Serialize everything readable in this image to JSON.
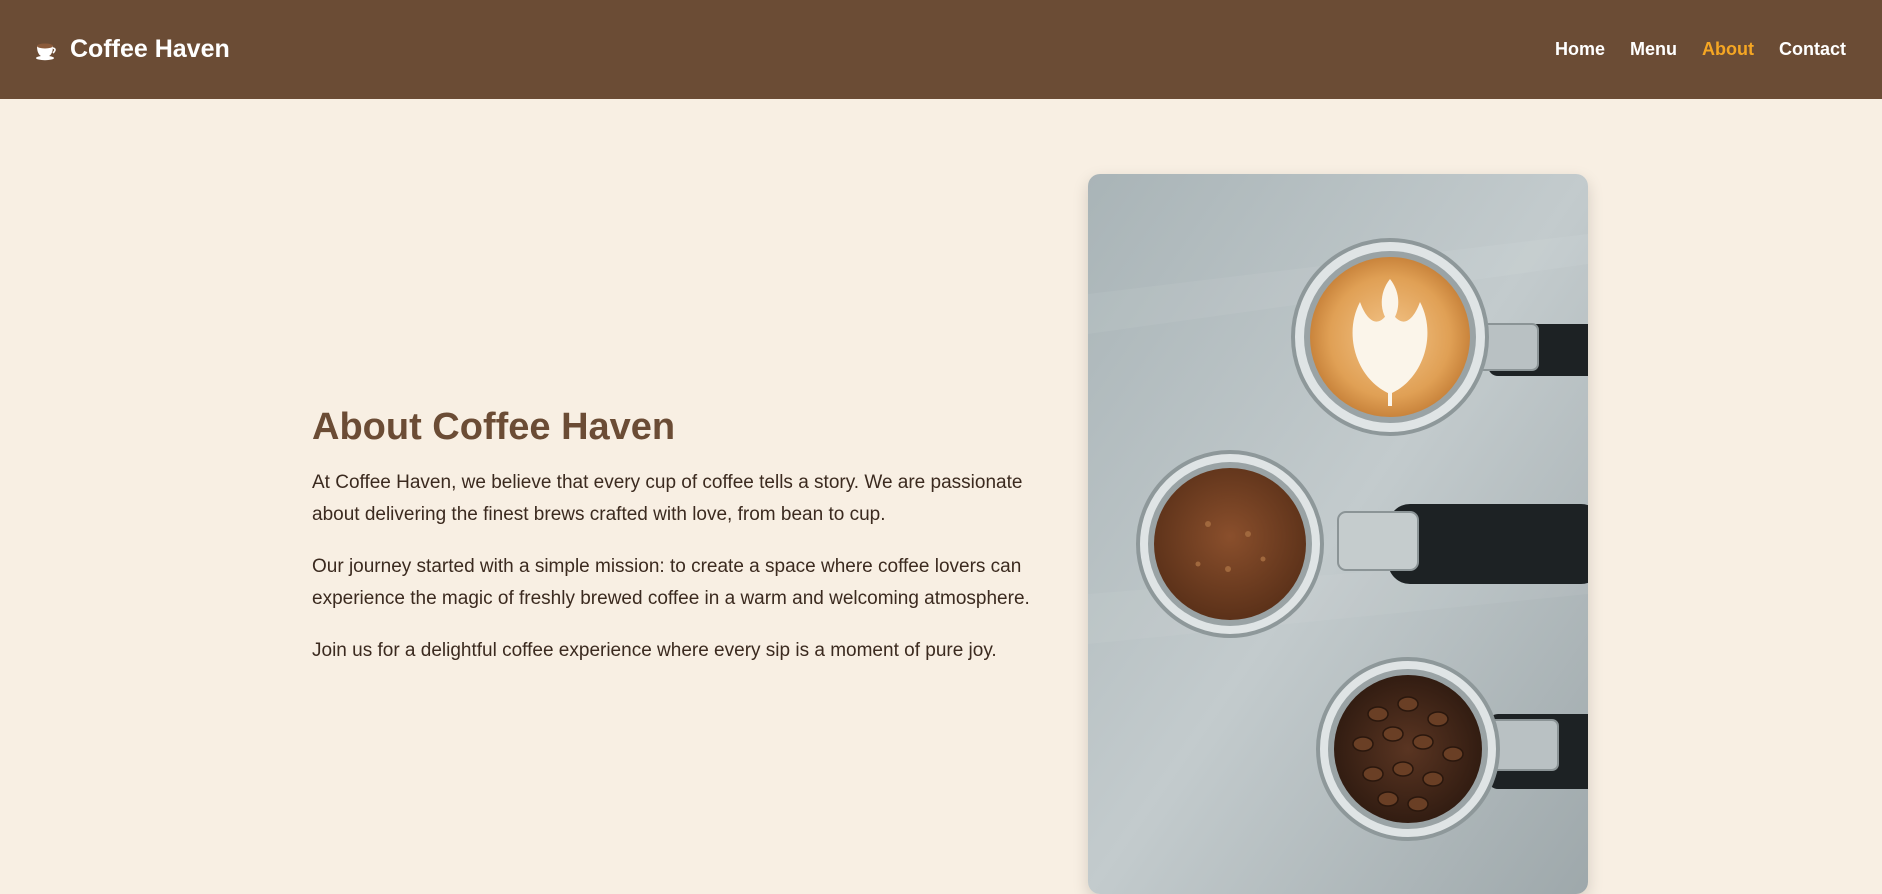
{
  "brand": {
    "name": "Coffee Haven",
    "icon": "coffee-cup-icon"
  },
  "nav": {
    "items": [
      {
        "label": "Home"
      },
      {
        "label": "Menu"
      },
      {
        "label": "About",
        "active": true
      },
      {
        "label": "Contact"
      }
    ]
  },
  "about": {
    "title": "About Coffee Haven",
    "paragraphs": [
      "At Coffee Haven, we believe that every cup of coffee tells a story. We are passionate about delivering the finest brews crafted with love, from bean to cup.",
      "Our journey started with a simple mission: to create a space where coffee lovers can experience the magic of freshly brewed coffee in a warm and welcoming atmosphere.",
      "Join us for a delightful coffee experience where every sip is a moment of pure joy."
    ]
  },
  "colors": {
    "header_bg": "#6b4c35",
    "page_bg": "#f8efe3",
    "accent": "#f5a623",
    "title": "#6b4c35"
  }
}
